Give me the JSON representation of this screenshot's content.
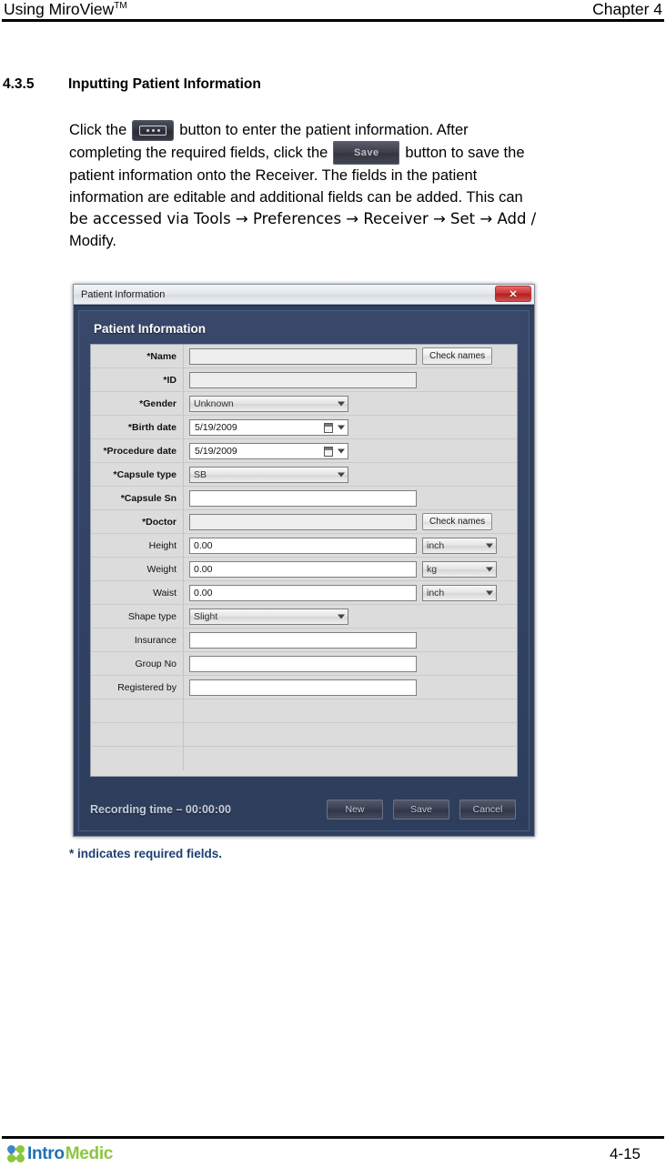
{
  "header": {
    "left_title": "Using MiroView",
    "trademark": "TM",
    "right_title": "Chapter 4"
  },
  "section": {
    "number": "4.3.5",
    "title": "Inputting Patient Information"
  },
  "paragraph": {
    "l1_a": "Click   the",
    "l1_b": "button   to   enter   the   patient   information.   After",
    "l2_a": "completing  the  required  fields,  click  the",
    "l2_b": "button  to  save  the",
    "l3": "patient   information   onto   the   Receiver.   The   fields   in   the   patient",
    "l4": "information are editable and additional fields can be added.    This can",
    "l5": "be  accessed  via  Tools  →  Preferences  →  Receiver  →  Set  →  Add  /",
    "l6": "Modify.",
    "inline_save_label": "Save"
  },
  "dialog": {
    "titlebar": "Patient Information",
    "close_label": "✕",
    "heading": "Patient Information",
    "rows": [
      {
        "label": "*Name",
        "required": true,
        "control": "text",
        "value": "",
        "readonly": true,
        "button": "Check names"
      },
      {
        "label": "*ID",
        "required": true,
        "control": "text",
        "value": "",
        "readonly": true,
        "button": ""
      },
      {
        "label": "*Gender",
        "required": true,
        "control": "select",
        "value": "Unknown",
        "readonly": false,
        "button": ""
      },
      {
        "label": "*Birth date",
        "required": true,
        "control": "date",
        "value": "5/19/2009",
        "readonly": false,
        "button": ""
      },
      {
        "label": "*Procedure date",
        "required": true,
        "control": "date",
        "value": "5/19/2009",
        "readonly": false,
        "button": ""
      },
      {
        "label": "*Capsule type",
        "required": true,
        "control": "select",
        "value": "SB",
        "readonly": false,
        "button": ""
      },
      {
        "label": "*Capsule Sn",
        "required": true,
        "control": "text",
        "value": "",
        "readonly": false,
        "button": ""
      },
      {
        "label": "*Doctor",
        "required": true,
        "control": "text",
        "value": "",
        "readonly": true,
        "button": "Check names"
      },
      {
        "label": "Height",
        "required": false,
        "control": "text",
        "value": "0.00",
        "readonly": false,
        "unit": "inch"
      },
      {
        "label": "Weight",
        "required": false,
        "control": "text",
        "value": "0.00",
        "readonly": false,
        "unit": "kg"
      },
      {
        "label": "Waist",
        "required": false,
        "control": "text",
        "value": "0.00",
        "readonly": false,
        "unit": "inch"
      },
      {
        "label": "Shape type",
        "required": false,
        "control": "select",
        "value": "Slight",
        "readonly": false,
        "button": ""
      },
      {
        "label": "Insurance",
        "required": false,
        "control": "text",
        "value": "",
        "readonly": false,
        "button": ""
      },
      {
        "label": "Group No",
        "required": false,
        "control": "text",
        "value": "",
        "readonly": false,
        "button": ""
      },
      {
        "label": "Registered by",
        "required": false,
        "control": "text",
        "value": "",
        "readonly": false,
        "button": ""
      },
      {
        "label": "",
        "required": false,
        "control": "none",
        "value": "",
        "readonly": false,
        "button": ""
      },
      {
        "label": "",
        "required": false,
        "control": "none",
        "value": "",
        "readonly": false,
        "button": ""
      },
      {
        "label": "",
        "required": false,
        "control": "none",
        "value": "",
        "readonly": false,
        "button": ""
      }
    ],
    "recording_time": "Recording time – 00:00:00",
    "buttons": {
      "new": "New",
      "save": "Save",
      "cancel": "Cancel"
    }
  },
  "caption": "* indicates required fields.",
  "footer": {
    "logo_intro": "Intro",
    "logo_medic": "Medic",
    "page_number": "4-15"
  },
  "colors": {
    "dialog_body": "#2f4161",
    "grid_bg": "#dcdcdc",
    "close_red": "#c72d2d",
    "caption_blue": "#1d3f72",
    "logo_blue": "#1f6fb4",
    "logo_green": "#8cc63f"
  }
}
